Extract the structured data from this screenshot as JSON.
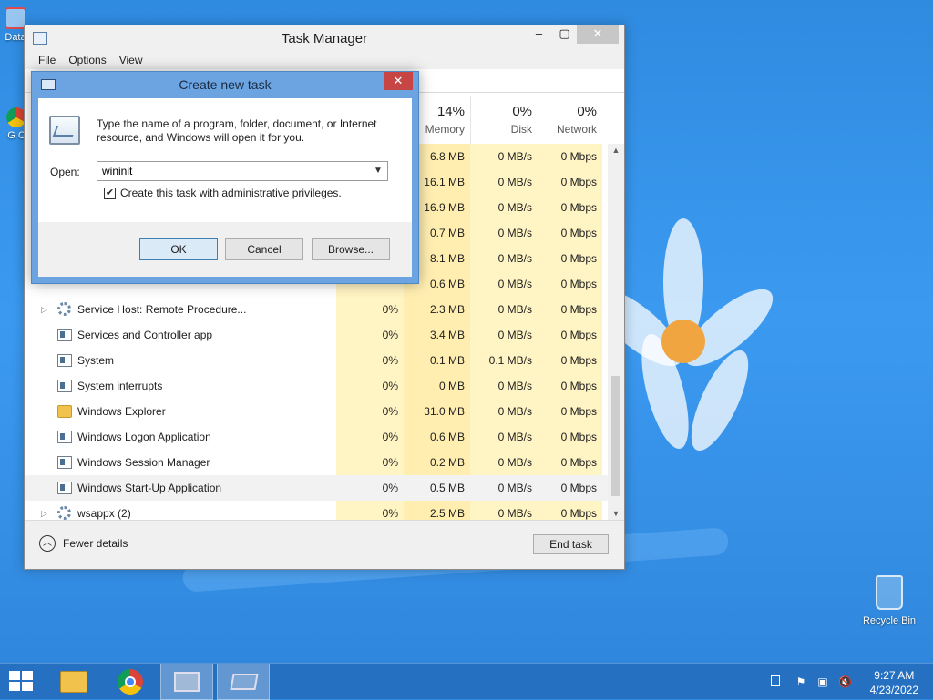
{
  "desktop": {
    "icons": [
      {
        "label": "Data"
      },
      {
        "label": "G C"
      }
    ],
    "recycle_bin": "Recycle Bin"
  },
  "task_manager": {
    "title": "Task Manager",
    "menu": [
      "File",
      "Options",
      "View"
    ],
    "columns": {
      "memory": {
        "pct": "14%",
        "label": "Memory"
      },
      "disk": {
        "pct": "0%",
        "label": "Disk"
      },
      "network": {
        "pct": "0%",
        "label": "Network"
      }
    },
    "rows": [
      {
        "name": "",
        "cpu": "",
        "memory": "6.8 MB",
        "disk": "0 MB/s",
        "network": "0 Mbps",
        "icon": "window",
        "expand": false
      },
      {
        "name": "",
        "cpu": "",
        "memory": "16.1 MB",
        "disk": "0 MB/s",
        "network": "0 Mbps",
        "icon": "window",
        "expand": false
      },
      {
        "name": "",
        "cpu": "",
        "memory": "16.9 MB",
        "disk": "0 MB/s",
        "network": "0 Mbps",
        "icon": "window",
        "expand": false
      },
      {
        "name": "",
        "cpu": "",
        "memory": "0.7 MB",
        "disk": "0 MB/s",
        "network": "0 Mbps",
        "icon": "window",
        "expand": false
      },
      {
        "name": "",
        "cpu": "",
        "memory": "8.1 MB",
        "disk": "0 MB/s",
        "network": "0 Mbps",
        "icon": "window",
        "expand": false
      },
      {
        "name": "",
        "cpu": "",
        "memory": "0.6 MB",
        "disk": "0 MB/s",
        "network": "0 Mbps",
        "icon": "window",
        "expand": false
      },
      {
        "name": "Service Host: Remote Procedure...",
        "cpu": "0%",
        "memory": "2.3 MB",
        "disk": "0 MB/s",
        "network": "0 Mbps",
        "icon": "gear",
        "expand": true
      },
      {
        "name": "Services and Controller app",
        "cpu": "0%",
        "memory": "3.4 MB",
        "disk": "0 MB/s",
        "network": "0 Mbps",
        "icon": "window",
        "expand": false
      },
      {
        "name": "System",
        "cpu": "0%",
        "memory": "0.1 MB",
        "disk": "0.1 MB/s",
        "network": "0 Mbps",
        "icon": "window",
        "expand": false
      },
      {
        "name": "System interrupts",
        "cpu": "0%",
        "memory": "0 MB",
        "disk": "0 MB/s",
        "network": "0 Mbps",
        "icon": "window",
        "expand": false
      },
      {
        "name": "Windows Explorer",
        "cpu": "0%",
        "memory": "31.0 MB",
        "disk": "0 MB/s",
        "network": "0 Mbps",
        "icon": "folder",
        "expand": false
      },
      {
        "name": "Windows Logon Application",
        "cpu": "0%",
        "memory": "0.6 MB",
        "disk": "0 MB/s",
        "network": "0 Mbps",
        "icon": "window",
        "expand": false
      },
      {
        "name": "Windows Session Manager",
        "cpu": "0%",
        "memory": "0.2 MB",
        "disk": "0 MB/s",
        "network": "0 Mbps",
        "icon": "window",
        "expand": false
      },
      {
        "name": "Windows Start-Up Application",
        "cpu": "0%",
        "memory": "0.5 MB",
        "disk": "0 MB/s",
        "network": "0 Mbps",
        "icon": "window",
        "expand": false,
        "selected": true
      },
      {
        "name": "wsappx (2)",
        "cpu": "0%",
        "memory": "2.5 MB",
        "disk": "0 MB/s",
        "network": "0 Mbps",
        "icon": "gear",
        "expand": true
      }
    ],
    "footer": {
      "fewer_details": "Fewer details",
      "end_task": "End task"
    }
  },
  "dialog": {
    "title": "Create new task",
    "description": "Type the name of a program, folder, document, or Internet resource, and Windows will open it for you.",
    "open_label": "Open:",
    "open_value": "wininit",
    "admin_checkbox_label": "Create this task with administrative privileges.",
    "admin_checked": true,
    "ok": "OK",
    "cancel": "Cancel",
    "browse": "Browse..."
  },
  "taskbar": {
    "clock_time": "9:27 AM",
    "clock_date": "4/23/2022"
  }
}
